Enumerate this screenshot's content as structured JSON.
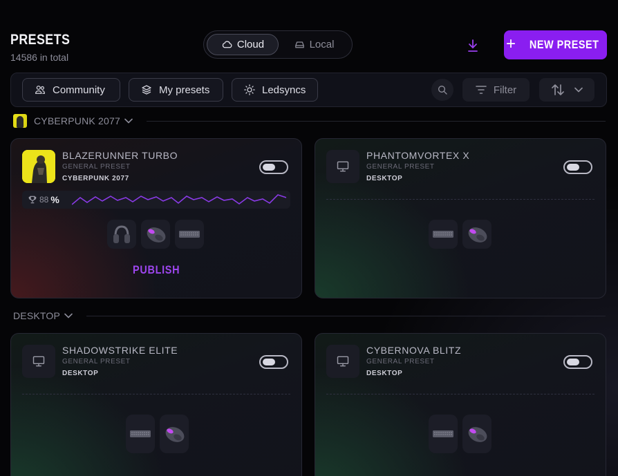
{
  "header": {
    "title": "PRESETS",
    "count_text": "14586 in total",
    "tabs": [
      {
        "label": "Cloud",
        "icon": "cloud-icon",
        "active": true
      },
      {
        "label": "Local",
        "icon": "drive-icon",
        "active": false
      }
    ],
    "download_icon": "download-icon",
    "new_preset_label": "NEW PRESET"
  },
  "toolbar": {
    "chips": [
      {
        "label": "Community",
        "icon": "users-icon"
      },
      {
        "label": "My presets",
        "icon": "layers-icon"
      },
      {
        "label": "Ledsyncs",
        "icon": "sun-icon"
      }
    ],
    "search_icon": "search-icon",
    "filter_label": "Filter",
    "sort_icon": "sort-arrows-icon"
  },
  "sections": [
    {
      "label": "CYBERPUNK 2077",
      "cards": [
        {
          "name": "BLAZERUNNER TURBO",
          "type": "GENERAL PRESET",
          "subtitle": "CYBERPUNK 2077",
          "thumb": "game-cover",
          "toggle_on": false,
          "performance": {
            "value": "88",
            "unit": "%"
          },
          "devices": [
            "headset-icon",
            "mouse-icon",
            "keyboard-icon"
          ],
          "action": "PUBLISH"
        },
        {
          "name": "PHANTOMVORTEX X",
          "type": "GENERAL PRESET",
          "subtitle": "DESKTOP",
          "thumb": "monitor-icon",
          "toggle_on": false,
          "devices": [
            "keyboard-icon",
            "mouse-icon"
          ]
        }
      ]
    },
    {
      "label": "DESKTOP",
      "cards": [
        {
          "name": "SHADOWSTRIKE ELITE",
          "type": "GENERAL PRESET",
          "subtitle": "DESKTOP",
          "thumb": "monitor-icon",
          "toggle_on": false,
          "devices": [
            "keyboard-icon",
            "mouse-icon"
          ]
        },
        {
          "name": "CYBERNOVA BLITZ",
          "type": "GENERAL PRESET",
          "subtitle": "DESKTOP",
          "thumb": "monitor-icon",
          "toggle_on": false,
          "devices": [
            "keyboard-icon",
            "mouse-icon"
          ]
        }
      ]
    }
  ],
  "colors": {
    "accent": "#8a1ef0",
    "publish": "#9d46ee",
    "background": "#050507",
    "sparkline": "#8a3ae6"
  }
}
